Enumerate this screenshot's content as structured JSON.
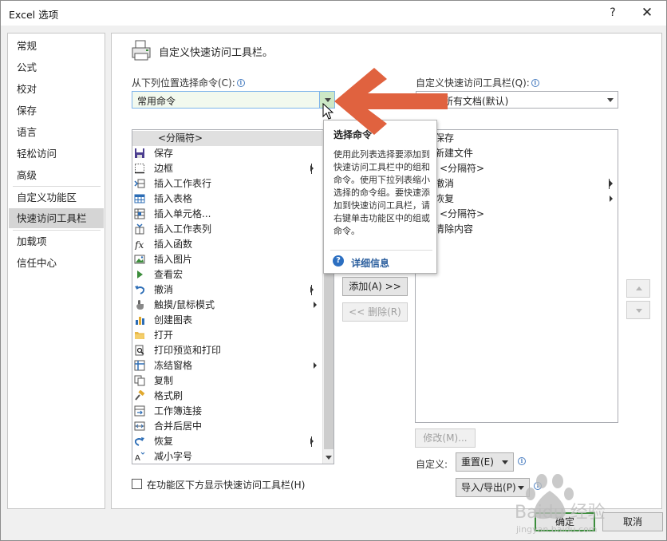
{
  "window": {
    "title": "Excel 选项",
    "help_label": "?",
    "close_label": "✕"
  },
  "sidebar": {
    "items": [
      {
        "label": "常规"
      },
      {
        "label": "公式"
      },
      {
        "label": "校对"
      },
      {
        "label": "保存"
      },
      {
        "label": "语言"
      },
      {
        "label": "轻松访问"
      },
      {
        "label": "高级"
      },
      {
        "label": "自定义功能区"
      },
      {
        "label": "快速访问工具栏",
        "active": true
      },
      {
        "label": "加载项"
      },
      {
        "label": "信任中心"
      }
    ]
  },
  "main": {
    "title": "自定义快速访问工具栏。",
    "choose_label": "从下列位置选择命令(C):",
    "choose_value": "常用命令",
    "customize_label": "自定义快速访问工具栏(Q):",
    "customize_value": "用于所有文档(默认)",
    "commands": [
      {
        "label": "<分隔符>",
        "separator": true
      },
      {
        "label": "保存",
        "icon": "save-icon"
      },
      {
        "label": "边框",
        "icon": "border-icon",
        "submenu": "bar"
      },
      {
        "label": "插入工作表行",
        "icon": "insert-row-icon"
      },
      {
        "label": "插入表格",
        "icon": "table-icon"
      },
      {
        "label": "插入单元格...",
        "icon": "insert-cell-icon"
      },
      {
        "label": "插入工作表列",
        "icon": "insert-column-icon"
      },
      {
        "label": "插入函数",
        "icon": "function-icon"
      },
      {
        "label": "插入图片",
        "icon": "picture-icon"
      },
      {
        "label": "查看宏",
        "icon": "macro-icon"
      },
      {
        "label": "撤消",
        "icon": "undo-icon",
        "submenu": "bar"
      },
      {
        "label": "触摸/鼠标模式",
        "icon": "touch-icon",
        "submenu": "arrow"
      },
      {
        "label": "创建图表",
        "icon": "chart-icon"
      },
      {
        "label": "打开",
        "icon": "folder-icon"
      },
      {
        "label": "打印预览和打印",
        "icon": "print-preview-icon"
      },
      {
        "label": "冻结窗格",
        "icon": "freeze-icon",
        "submenu": "arrow"
      },
      {
        "label": "复制",
        "icon": "copy-icon"
      },
      {
        "label": "格式刷",
        "icon": "format-painter-icon"
      },
      {
        "label": "工作簿连接",
        "icon": "connection-icon"
      },
      {
        "label": "合并后居中",
        "icon": "merge-icon"
      },
      {
        "label": "恢复",
        "icon": "redo-icon",
        "submenu": "bar"
      },
      {
        "label": "减小字号",
        "icon": "font-decrease-icon"
      }
    ],
    "toolbar_items": [
      {
        "label": "保存"
      },
      {
        "label": "新建文件"
      },
      {
        "label": "<分隔符>"
      },
      {
        "label": "撤消",
        "submenu": true
      },
      {
        "label": "恢复",
        "submenu": true
      },
      {
        "label": "<分隔符>"
      },
      {
        "label": "清除内容"
      }
    ],
    "add_button": "添加(A) >>",
    "remove_button": "<< 删除(R)",
    "modify_button": "修改(M)...",
    "customize_caption": "自定义:",
    "reset_button": "重置(E)",
    "import_export_button": "导入/导出(P)",
    "show_below_label": "在功能区下方显示快速访问工具栏(H)",
    "ok_button": "确定",
    "cancel_button": "取消"
  },
  "tooltip": {
    "title": "选择命令",
    "body": "使用此列表选择要添加到快速访问工具栏中的组和命令。使用下拉列表缩小选择的命令组。要快速添加到快速访问工具栏，请右键单击功能区中的组或命令。",
    "link": "详细信息"
  },
  "watermark": {
    "text": "Baidu 经验",
    "url": "jingyan.baidu.com"
  },
  "colors": {
    "annotation_arrow": "#e0623f",
    "accent_green": "#3c8d3c",
    "link_blue": "#2c5f9e"
  }
}
